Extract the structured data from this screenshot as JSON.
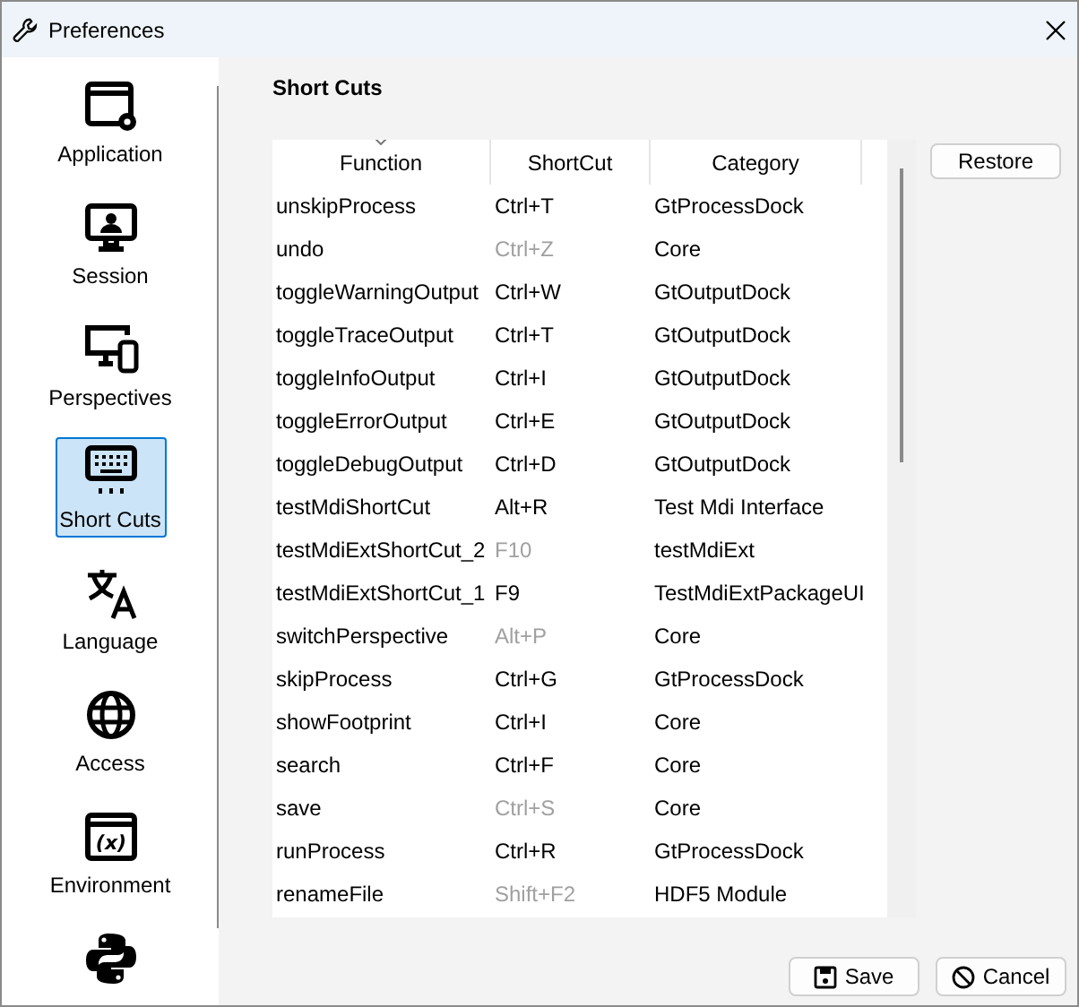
{
  "window": {
    "title": "Preferences"
  },
  "sidebar": {
    "items": [
      {
        "label": "Application",
        "selected": false
      },
      {
        "label": "Session",
        "selected": false
      },
      {
        "label": "Perspectives",
        "selected": false
      },
      {
        "label": "Short Cuts",
        "selected": true
      },
      {
        "label": "Language",
        "selected": false
      },
      {
        "label": "Access",
        "selected": false
      },
      {
        "label": "Environment",
        "icon_text": "(x)",
        "selected": false
      },
      {
        "selected": false
      }
    ]
  },
  "page": {
    "title": "Short Cuts"
  },
  "table": {
    "columns": [
      "Function",
      "ShortCut",
      "Category"
    ],
    "rows": [
      {
        "function": "unskipProcess",
        "shortcut": "Ctrl+T",
        "disabled": false,
        "category": "GtProcessDock"
      },
      {
        "function": "undo",
        "shortcut": "Ctrl+Z",
        "disabled": true,
        "category": "Core"
      },
      {
        "function": "toggleWarningOutput",
        "shortcut": "Ctrl+W",
        "disabled": false,
        "category": "GtOutputDock"
      },
      {
        "function": "toggleTraceOutput",
        "shortcut": "Ctrl+T",
        "disabled": false,
        "category": "GtOutputDock"
      },
      {
        "function": "toggleInfoOutput",
        "shortcut": "Ctrl+I",
        "disabled": false,
        "category": "GtOutputDock"
      },
      {
        "function": "toggleErrorOutput",
        "shortcut": "Ctrl+E",
        "disabled": false,
        "category": "GtOutputDock"
      },
      {
        "function": "toggleDebugOutput",
        "shortcut": "Ctrl+D",
        "disabled": false,
        "category": "GtOutputDock"
      },
      {
        "function": "testMdiShortCut",
        "shortcut": "Alt+R",
        "disabled": false,
        "category": "Test Mdi Interface"
      },
      {
        "function": "testMdiExtShortCut_2",
        "shortcut": "F10",
        "disabled": true,
        "category": "testMdiExt"
      },
      {
        "function": "testMdiExtShortCut_1",
        "shortcut": "F9",
        "disabled": false,
        "category": "TestMdiExtPackageUI"
      },
      {
        "function": "switchPerspective",
        "shortcut": "Alt+P",
        "disabled": true,
        "category": "Core"
      },
      {
        "function": "skipProcess",
        "shortcut": "Ctrl+G",
        "disabled": false,
        "category": "GtProcessDock"
      },
      {
        "function": "showFootprint",
        "shortcut": "Ctrl+I",
        "disabled": false,
        "category": "Core"
      },
      {
        "function": "search",
        "shortcut": "Ctrl+F",
        "disabled": false,
        "category": "Core"
      },
      {
        "function": "save",
        "shortcut": "Ctrl+S",
        "disabled": true,
        "category": "Core"
      },
      {
        "function": "runProcess",
        "shortcut": "Ctrl+R",
        "disabled": false,
        "category": "GtProcessDock"
      },
      {
        "function": "renameFile",
        "shortcut": "Shift+F2",
        "disabled": true,
        "category": "HDF5 Module"
      }
    ]
  },
  "restore_button": "Restore",
  "buttons": [
    "Save",
    "Cancel"
  ]
}
